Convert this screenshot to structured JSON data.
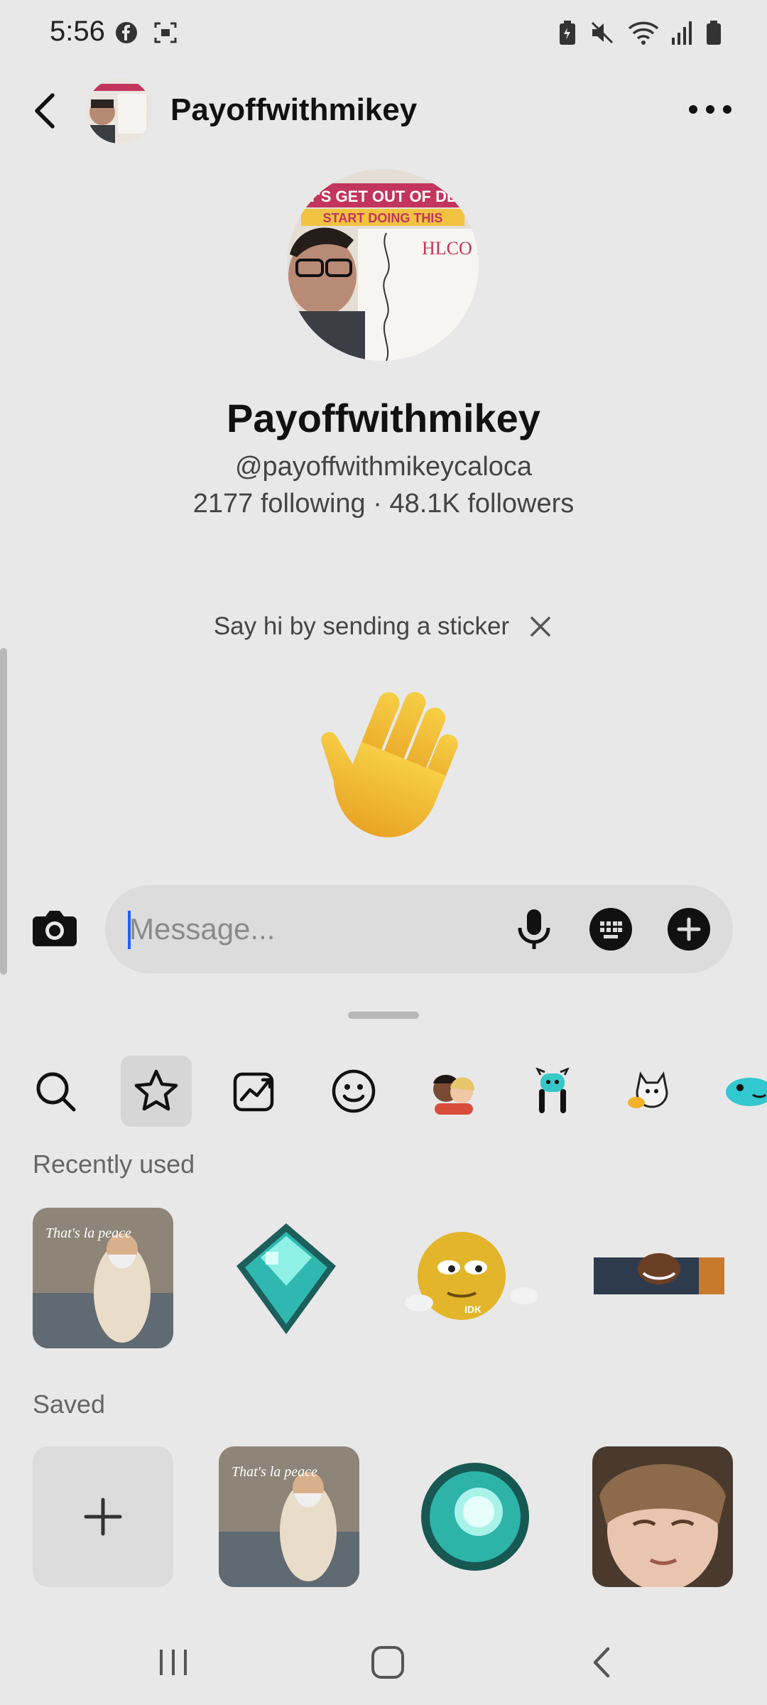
{
  "status_bar": {
    "time": "5:56",
    "left_icons": [
      "facebook-icon",
      "screenshot-icon"
    ],
    "right_icons": [
      "battery-saver-icon",
      "mute-icon",
      "wifi-icon",
      "signal-icon",
      "battery-icon"
    ]
  },
  "header": {
    "title": "Payoffwithmikey",
    "back_icon": "back-arrow-icon",
    "more_icon": "more-dots-icon"
  },
  "profile": {
    "name": "Payoffwithmikey",
    "handle": "@payoffwithmikeycaloca",
    "stats": "2177 following · 48.1K followers",
    "avatar_caption_top": "LET'S GET OUT OF DEBT",
    "avatar_caption_sub": "START DOING THIS",
    "avatar_board_text": "HLCO Payment"
  },
  "hint": {
    "text": "Say hi by sending a sticker",
    "close_icon": "close-icon",
    "sticker": "waving-hand"
  },
  "composer": {
    "placeholder": "Message...",
    "value": "",
    "icons": [
      "camera-icon",
      "microphone-icon",
      "keyboard-icon",
      "plus-circle-icon"
    ]
  },
  "sticker_tabs": [
    {
      "name": "search-icon",
      "active": false
    },
    {
      "name": "star-icon",
      "active": true
    },
    {
      "name": "trending-icon",
      "active": false
    },
    {
      "name": "smiley-icon",
      "active": false
    },
    {
      "name": "avatar-pair-icon",
      "active": false
    },
    {
      "name": "character-icon",
      "active": false
    },
    {
      "name": "cat-sticker-icon",
      "active": false
    },
    {
      "name": "blue-creature-icon",
      "active": false
    }
  ],
  "sections": {
    "recently_used": {
      "label": "Recently used",
      "items": [
        {
          "name": "thats-la-peace-sticker",
          "caption": "That's la peace"
        },
        {
          "name": "pixel-diamond-sticker"
        },
        {
          "name": "idk-emoji-sticker",
          "caption": "IDK"
        },
        {
          "name": "reaction-gif-sticker"
        }
      ]
    },
    "saved": {
      "label": "Saved",
      "items": [
        {
          "name": "add-sticker-button"
        },
        {
          "name": "thats-la-peace-sticker",
          "caption": "That's la peace"
        },
        {
          "name": "pixel-ender-pearl-sticker"
        },
        {
          "name": "face-sticker"
        }
      ]
    }
  },
  "nav_bar": {
    "buttons": [
      "recents-icon",
      "home-icon",
      "back-icon"
    ]
  },
  "colors": {
    "background": "#e8e8e8",
    "caret": "#1f5eff",
    "field": "#dcdcdc",
    "wave_yellow": "#f2c12e"
  }
}
